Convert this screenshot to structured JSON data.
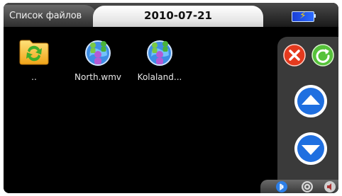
{
  "header": {
    "title": "Список файлов",
    "date": "2010-07-21",
    "battery_icon": "battery-charging-icon"
  },
  "files": [
    {
      "label": "..",
      "icon": "folder-up-icon"
    },
    {
      "label": "North.wmv",
      "icon": "media-file-icon"
    },
    {
      "label": "Kolaland...",
      "icon": "media-file-icon"
    }
  ],
  "side_buttons": {
    "close_icon": "close-icon",
    "refresh_icon": "refresh-icon",
    "up_icon": "arrow-up-icon",
    "down_icon": "arrow-down-icon"
  },
  "statusbar": {
    "icons": [
      "bluetooth-icon",
      "music-icon",
      "speaker-icon"
    ]
  },
  "colors": {
    "background": "#000000",
    "date_pill": "#ffffff",
    "accent_blue": "#1f6fe0",
    "close_red": "#e53a1e",
    "refresh_green": "#56c23a"
  }
}
